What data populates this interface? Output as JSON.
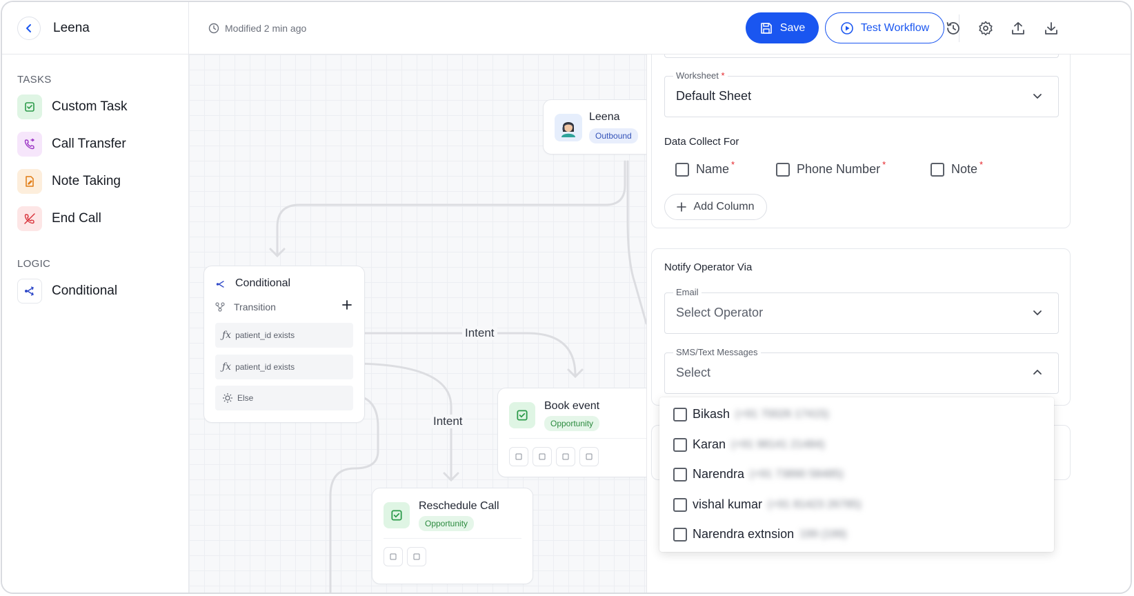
{
  "sidebar": {
    "title": "Leena",
    "tasks_heading": "TASKS",
    "tasks": [
      {
        "label": "Custom Task",
        "icon": "checklist-icon",
        "bg": "#dff5e4",
        "color": "#2b9a49"
      },
      {
        "label": "Call Transfer",
        "icon": "phone-transfer-icon",
        "bg": "#f6e6fb",
        "color": "#9b35c4"
      },
      {
        "label": "Note Taking",
        "icon": "note-icon",
        "bg": "#fdeedc",
        "color": "#e07a12"
      },
      {
        "label": "End Call",
        "icon": "end-call-icon",
        "bg": "#fde6e6",
        "color": "#d9363e"
      }
    ],
    "logic_heading": "LOGIC",
    "logic": [
      {
        "label": "Conditional",
        "icon": "branch-icon",
        "bg": "#ffffff",
        "color": "#2f49c8"
      }
    ]
  },
  "topbar": {
    "modified": "Modified 2 min ago",
    "save_label": "Save",
    "test_label": "Test Workflow",
    "icons": [
      "history-icon",
      "settings-icon",
      "upload-icon",
      "download-icon"
    ]
  },
  "canvas": {
    "start_node": {
      "title": "Leena",
      "badge": "Outbound"
    },
    "conditional_node": {
      "title": "Conditional",
      "transition": "Transition",
      "rows": [
        "patient_id exists",
        "patient_id exists",
        "Else"
      ]
    },
    "edge_labels": [
      "Intent",
      "Intent"
    ],
    "book_node": {
      "title": "Book event",
      "badge": "Opportunity"
    },
    "reschedule_node": {
      "title": "Reschedule Call",
      "badge": "Opportunity"
    }
  },
  "panel": {
    "worksheet": {
      "label": "Worksheet",
      "value": "Default Sheet"
    },
    "data_collect": {
      "title": "Data Collect For",
      "fields": [
        "Name",
        "Phone Number",
        "Note"
      ],
      "add_column": "Add Column"
    },
    "notify": {
      "title": "Notify Operator Via",
      "email": {
        "label": "Email",
        "placeholder": "Select Operator"
      },
      "sms": {
        "label": "SMS/Text Messages",
        "placeholder": "Select"
      }
    },
    "operators": [
      {
        "name": "Bikash",
        "phone": "(+91 70026 17415)"
      },
      {
        "name": "Karan",
        "phone": "(+91 98141 21484)"
      },
      {
        "name": "Narendra",
        "phone": "(+91 73890 58485)"
      },
      {
        "name": "vishal kumar",
        "phone": "(+91 81423 26785)"
      },
      {
        "name": "Narendra extnsion",
        "phone": "199 (199)"
      }
    ]
  },
  "colors": {
    "accent": "#1a56f0",
    "required": "#e5252a",
    "opportunity_badge": "#e5f6e9"
  }
}
